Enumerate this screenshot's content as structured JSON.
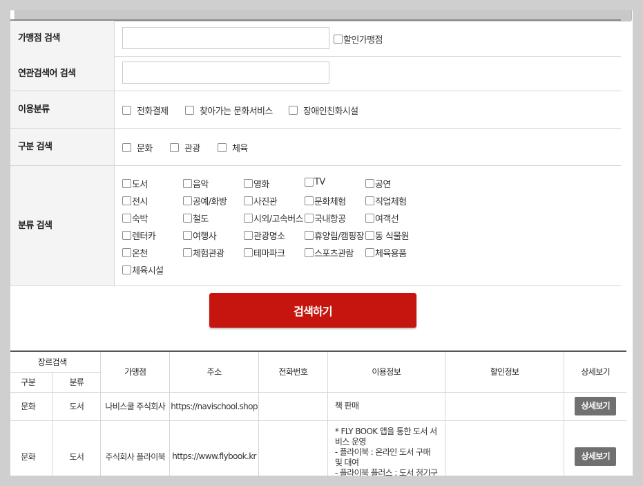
{
  "form": {
    "merchant_label": "가맹점 검색",
    "merchant_value": "",
    "discount_label": "할인가맹점",
    "keyword_label": "연관검색어 검색",
    "keyword_value": "",
    "usage_label": "이용분류",
    "usage_options": [
      "전화결제",
      "찾아가는 문화서비스",
      "장애인친화시설"
    ],
    "type_label": "구분 검색",
    "type_options": [
      "문화",
      "관광",
      "체육"
    ],
    "category_label": "분류 검색",
    "category_options": [
      "도서",
      "음악",
      "영화",
      "TV",
      "공연",
      "전시",
      "공예/화방",
      "사진관",
      "문화체험",
      "직업체험",
      "숙박",
      "철도",
      "시외/고속버스",
      "국내항공",
      "여객선",
      "렌터카",
      "여행사",
      "관광명소",
      "휴양림/캠핑장",
      "동 식물원",
      "온천",
      "체험관광",
      "테마파크",
      "스포츠관람",
      "체육용품",
      "체육시설"
    ],
    "search_button": "검색하기"
  },
  "results": {
    "headers": {
      "genre_search": "장르검색",
      "type": "구분",
      "category": "분류",
      "merchant": "가맹점",
      "address": "주소",
      "phone": "전화번호",
      "usage_info": "이용정보",
      "discount_info": "할인정보",
      "detail": "상세보기"
    },
    "rows": [
      {
        "type": "문화",
        "category": "도서",
        "merchant": "나비스쿨 주식회사",
        "address": "https://navischool.shop",
        "phone": "",
        "usage_info": [
          "책 판매"
        ],
        "discount_info": "",
        "detail": "상세보기"
      },
      {
        "type": "문화",
        "category": "도서",
        "merchant": "주식회사 플라이북",
        "address": "https://www.flybook.kr",
        "phone": "",
        "usage_info": [
          "* FLY BOOK 앱을 통한 도서 서비스 운영",
          "- 플라이북 : 온라인 도서 구매 및 대여",
          "- 플라이북 플러스 : 도서 정기구독 멤버십"
        ],
        "discount_info": "",
        "detail": "상세보기"
      }
    ]
  }
}
